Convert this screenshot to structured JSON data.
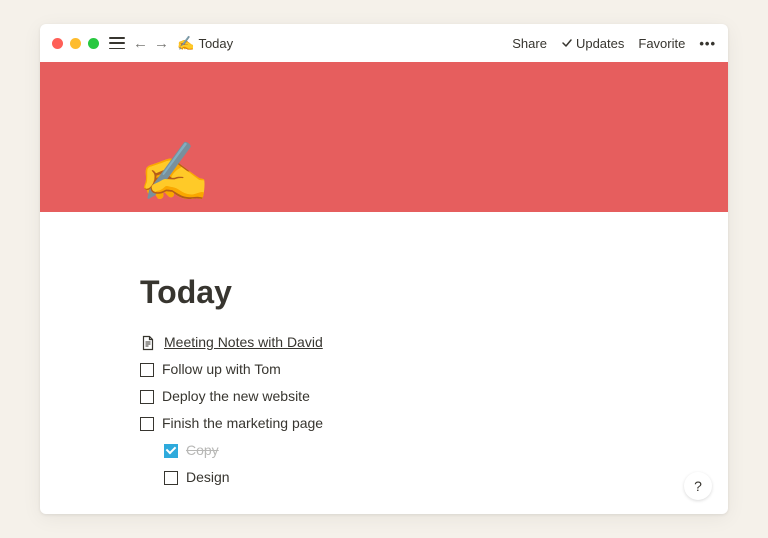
{
  "toolbar": {
    "crumb_emoji": "✍️",
    "crumb_title": "Today",
    "share": "Share",
    "updates": "Updates",
    "favorite": "Favorite"
  },
  "page": {
    "icon": "✍️",
    "title": "Today",
    "cover_color": "#e65e5e"
  },
  "items": [
    {
      "type": "page",
      "label": "Meeting Notes with David"
    },
    {
      "type": "todo",
      "checked": false,
      "label": "Follow up with Tom"
    },
    {
      "type": "todo",
      "checked": false,
      "label": "Deploy the new website"
    },
    {
      "type": "todo",
      "checked": false,
      "label": "Finish the marketing page"
    },
    {
      "type": "todo",
      "checked": true,
      "indent": true,
      "label": "Copy"
    },
    {
      "type": "todo",
      "checked": false,
      "indent": true,
      "label": "Design"
    }
  ],
  "help": "?"
}
